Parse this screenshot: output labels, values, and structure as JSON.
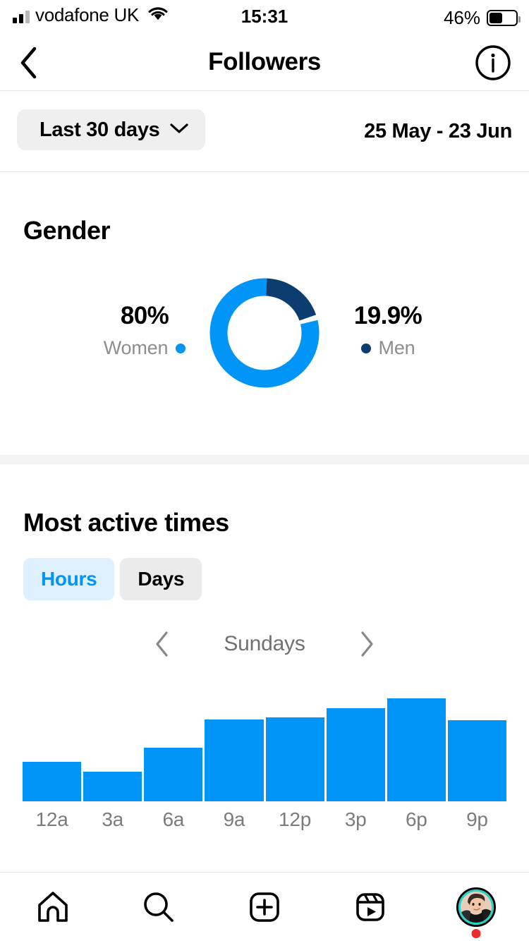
{
  "status_bar": {
    "carrier": "vodafone UK",
    "time": "15:31",
    "battery_percent": "46%",
    "signal_icon": "cellular-signal-icon",
    "wifi_icon": "wifi-icon",
    "battery_icon": "battery-icon"
  },
  "header": {
    "title": "Followers",
    "back_icon": "chevron-left-icon",
    "info_icon": "info-circle-icon"
  },
  "filter": {
    "range_label": "Last 30 days",
    "chevron_icon": "chevron-down-icon",
    "date_range": "25 May - 23 Jun"
  },
  "gender": {
    "title": "Gender",
    "women": {
      "percent": "80%",
      "label": "Women",
      "color": "#0095f6"
    },
    "men": {
      "percent": "19.9%",
      "label": "Men",
      "color": "#0d3d6e"
    }
  },
  "active_times": {
    "title": "Most active times",
    "tabs": [
      {
        "label": "Hours",
        "active": true
      },
      {
        "label": "Days",
        "active": false
      }
    ],
    "day_selector": {
      "day": "Sundays",
      "prev_icon": "chevron-left-icon",
      "next_icon": "chevron-right-icon"
    }
  },
  "tab_bar": {
    "items": [
      {
        "name": "home",
        "icon": "home-icon"
      },
      {
        "name": "search",
        "icon": "search-icon"
      },
      {
        "name": "create",
        "icon": "plus-square-icon"
      },
      {
        "name": "reels",
        "icon": "reels-icon"
      },
      {
        "name": "profile",
        "icon": "profile-avatar"
      }
    ]
  },
  "chart_data": [
    {
      "type": "pie",
      "title": "Gender",
      "labels": [
        "Women",
        "Men"
      ],
      "values": [
        80.0,
        19.9
      ],
      "colors": [
        "#0095f6",
        "#0d3d6e"
      ],
      "donut": true,
      "legend_position": "sides",
      "annotations": [
        "80%",
        "19.9%"
      ]
    },
    {
      "type": "bar",
      "title": "Most active times",
      "subtitle": "Sundays",
      "categories": [
        "12a",
        "3a",
        "6a",
        "9a",
        "12p",
        "3p",
        "6p",
        "9p"
      ],
      "values": [
        56,
        42,
        76,
        116,
        119,
        132,
        146,
        115
      ],
      "xlabel": "",
      "ylabel": "",
      "ylim": [
        0,
        160
      ],
      "grid": false,
      "color": "#0095f6",
      "legend_position": "none"
    }
  ]
}
